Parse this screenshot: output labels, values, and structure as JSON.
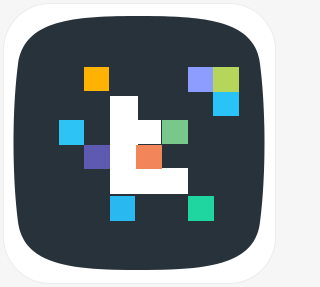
{
  "app_icon": {
    "name": "app-icon",
    "colors": {
      "plate": "#ffffff",
      "tile": "#27323a",
      "letter": "#ffffff",
      "orange": "#ffb300",
      "periwinkle": "#8c9cff",
      "lime": "#b5d65a",
      "sky": "#2dc4f5",
      "sky_light": "#29c3f7",
      "green": "#78c88b",
      "indigo": "#5e5ab1",
      "coral": "#f2865a",
      "blue": "#29b9f0",
      "teal": "#1fd6a0"
    },
    "pixels": [
      {
        "name": "orange-pixel",
        "color": "orange"
      },
      {
        "name": "periwinkle-pixel",
        "color": "periwinkle"
      },
      {
        "name": "lime-pixel",
        "color": "lime"
      },
      {
        "name": "sky-pixel-top-right",
        "color": "sky_light"
      },
      {
        "name": "sky-pixel-left",
        "color": "sky"
      },
      {
        "name": "green-pixel",
        "color": "green"
      },
      {
        "name": "indigo-pixel",
        "color": "indigo"
      },
      {
        "name": "coral-pixel",
        "color": "coral"
      },
      {
        "name": "blue-pixel-bottom",
        "color": "blue"
      },
      {
        "name": "teal-pixel-bottom",
        "color": "teal"
      }
    ]
  }
}
